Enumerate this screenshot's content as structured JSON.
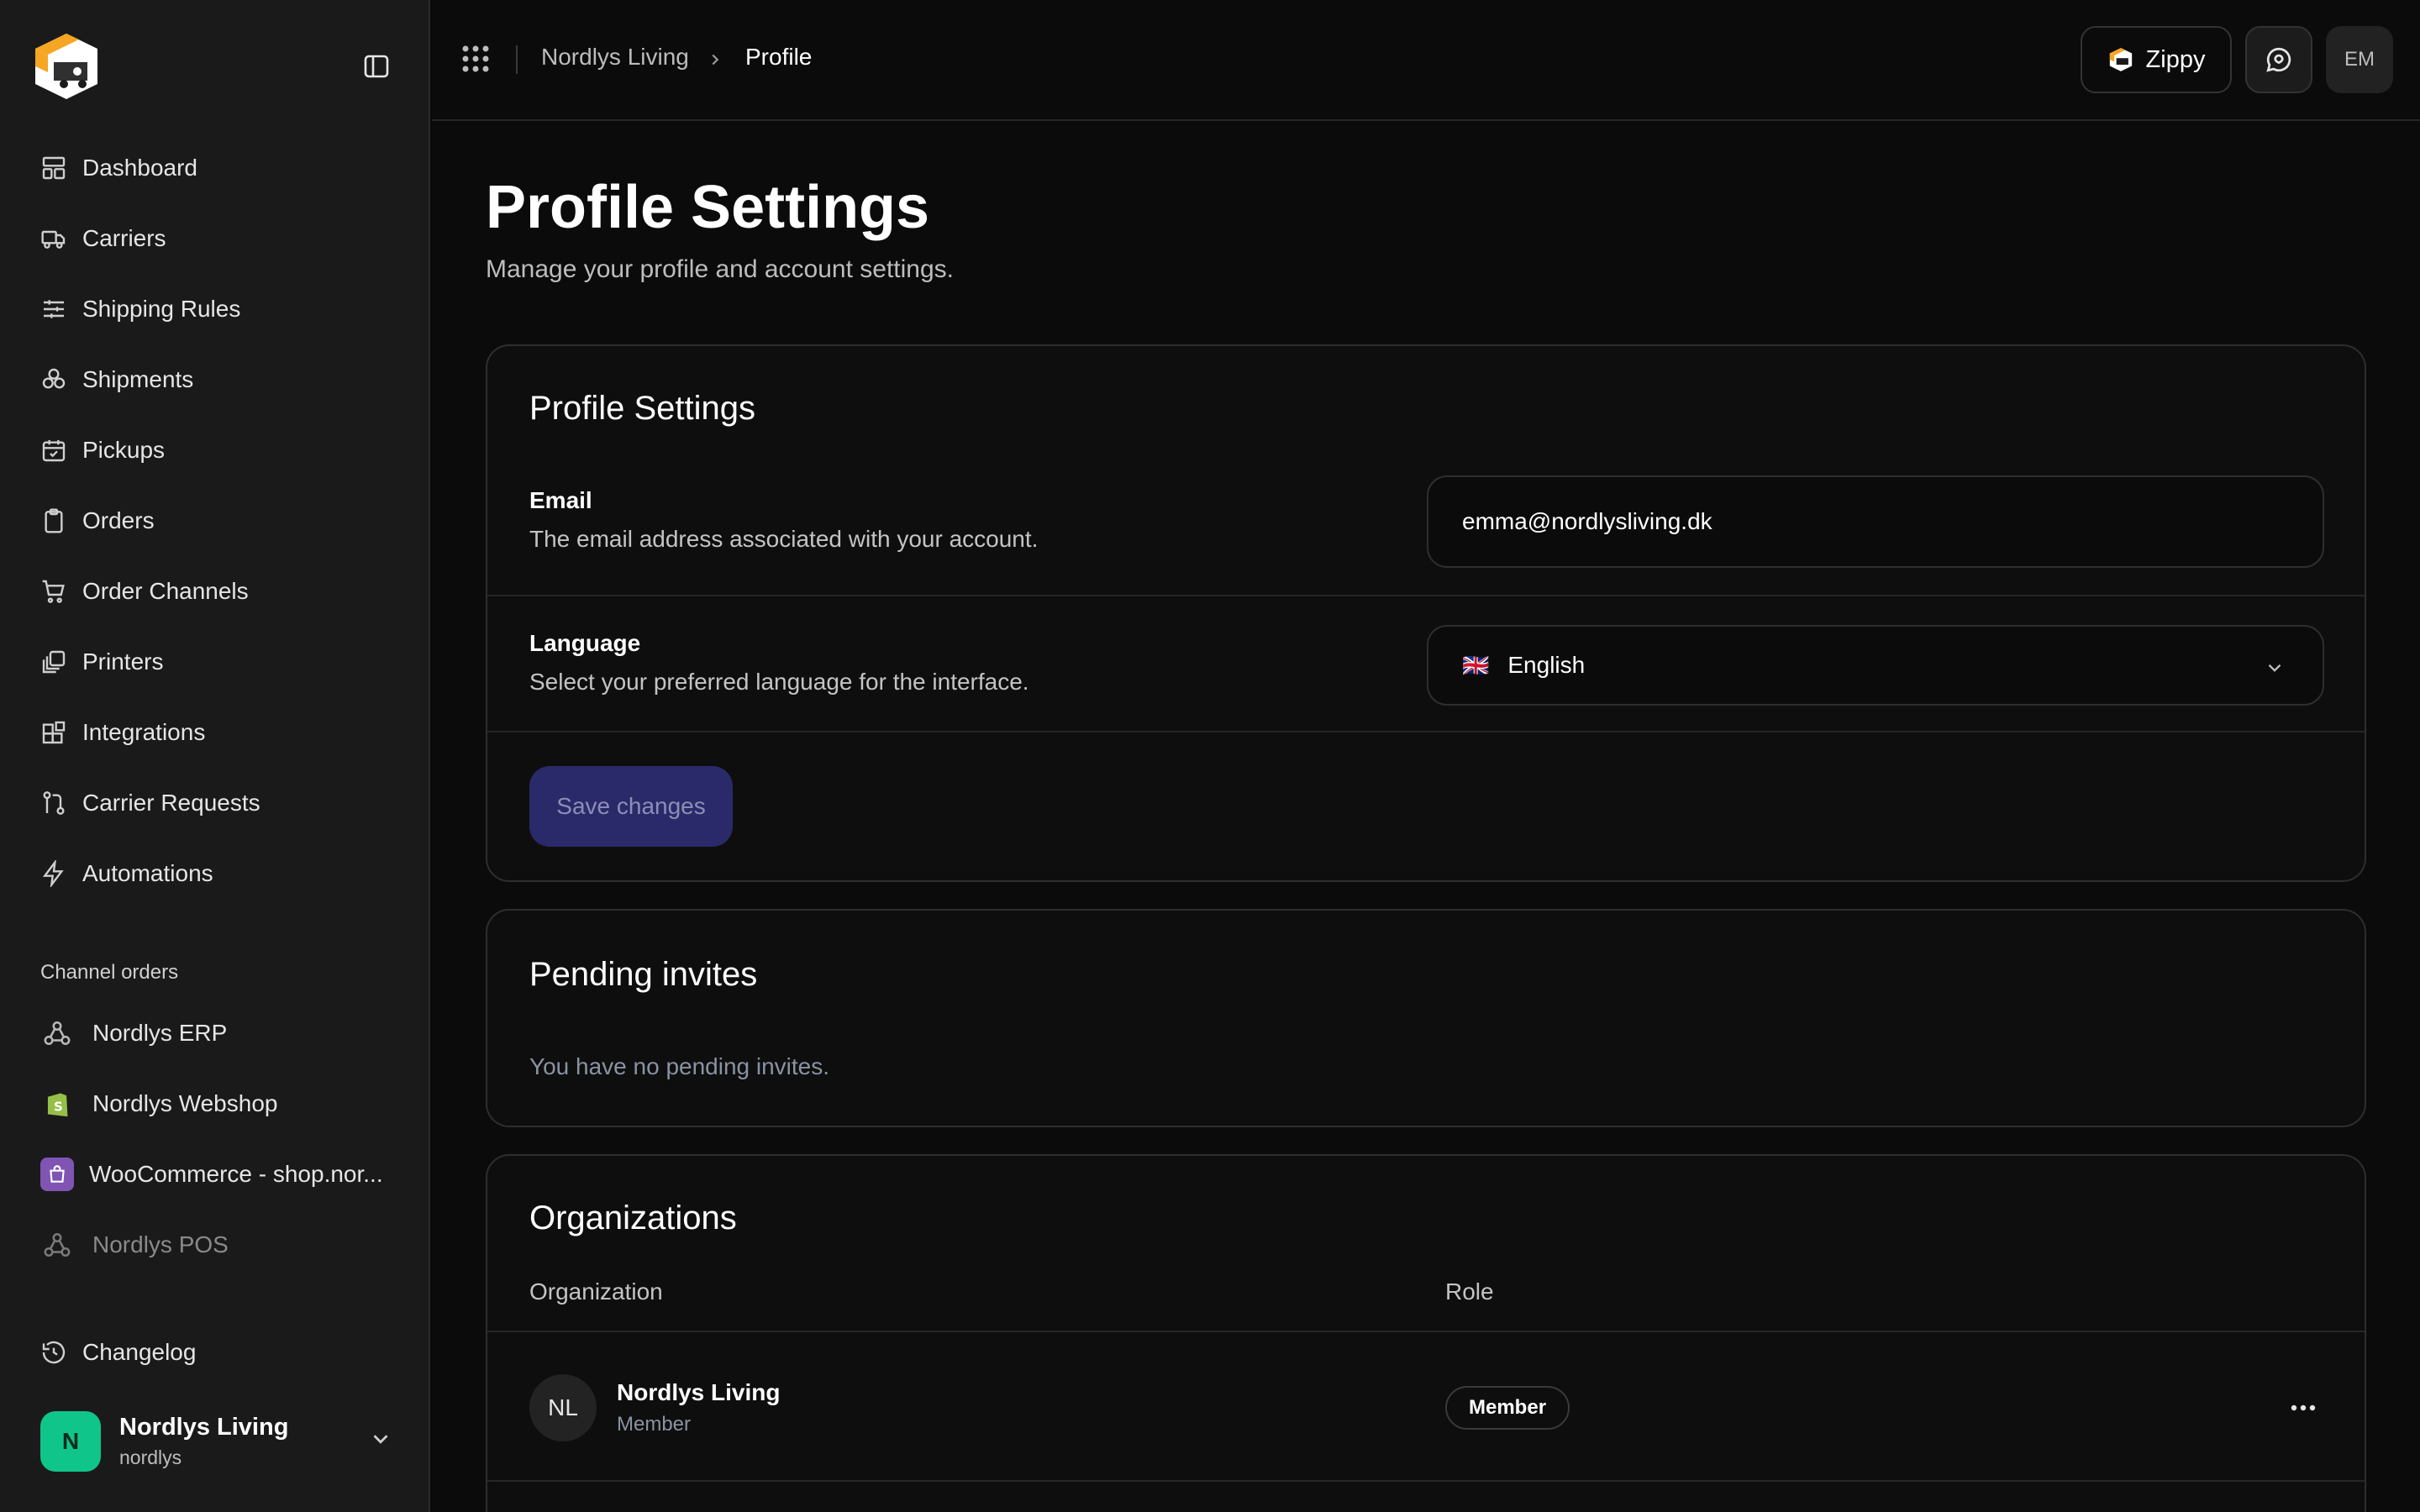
{
  "sidebar": {
    "nav": [
      {
        "label": "Dashboard",
        "icon": "dashboard-icon"
      },
      {
        "label": "Carriers",
        "icon": "truck-icon"
      },
      {
        "label": "Shipping Rules",
        "icon": "sliders-icon"
      },
      {
        "label": "Shipments",
        "icon": "boxes-icon"
      },
      {
        "label": "Pickups",
        "icon": "calendar-check-icon"
      },
      {
        "label": "Orders",
        "icon": "clipboard-icon"
      },
      {
        "label": "Order Channels",
        "icon": "cart-icon"
      },
      {
        "label": "Printers",
        "icon": "printer-icon"
      },
      {
        "label": "Integrations",
        "icon": "blocks-icon"
      },
      {
        "label": "Carrier Requests",
        "icon": "git-pull-icon"
      },
      {
        "label": "Automations",
        "icon": "bolt-icon"
      }
    ],
    "channel_section_label": "Channel orders",
    "channels": [
      {
        "label": "Nordlys ERP",
        "icon": "webhook-icon"
      },
      {
        "label": "Nordlys Webshop",
        "icon": "shopify-icon"
      },
      {
        "label": "WooCommerce - shop.nor...",
        "icon": "woocommerce-icon"
      },
      {
        "label": "Nordlys POS",
        "icon": "webhook-icon"
      }
    ],
    "changelog_label": "Changelog",
    "org": {
      "initial": "N",
      "name": "Nordlys Living",
      "slug": "nordlys",
      "accent": "#10c58a"
    }
  },
  "topbar": {
    "breadcrumb": [
      "Nordlys Living",
      "Profile"
    ],
    "zippy_label": "Zippy",
    "avatar_initials": "EM"
  },
  "page": {
    "title": "Profile Settings",
    "subtitle": "Manage your profile and account settings."
  },
  "profile_card": {
    "title": "Profile Settings",
    "email_label": "Email",
    "email_desc": "The email address associated with your account.",
    "email_value": "emma@nordlysliving.dk",
    "language_label": "Language",
    "language_desc": "Select your preferred language for the interface.",
    "language_flag": "🇬🇧",
    "language_value": "English",
    "save_label": "Save changes",
    "save_color": "#2a2a6a"
  },
  "invites_card": {
    "title": "Pending invites",
    "empty_text": "You have no pending invites."
  },
  "orgs_card": {
    "title": "Organizations",
    "col_org": "Organization",
    "col_role": "Role",
    "rows": [
      {
        "initials": "NL",
        "name": "Nordlys Living",
        "sub": "Member",
        "role": "Member"
      }
    ]
  }
}
